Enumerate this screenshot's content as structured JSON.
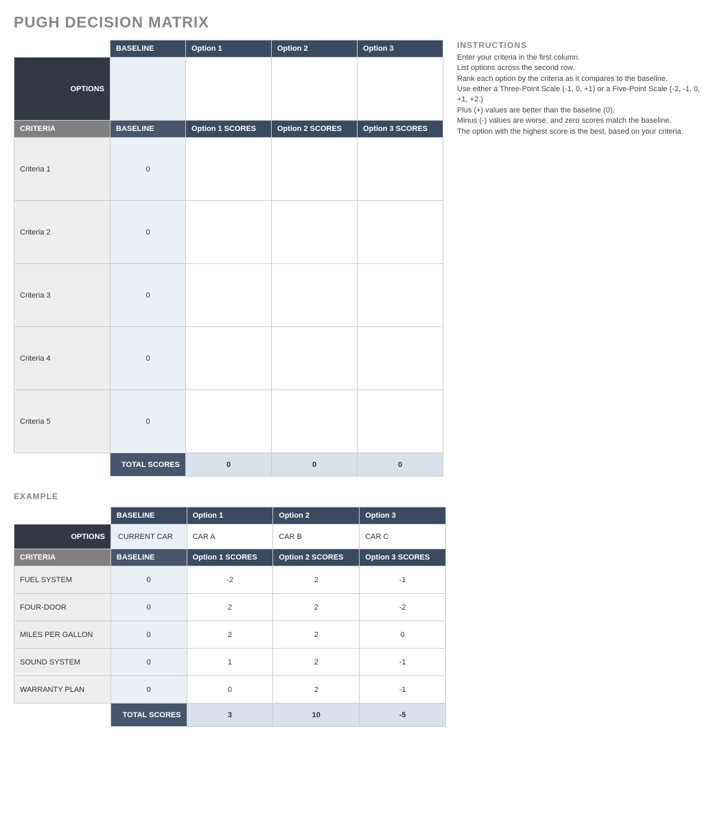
{
  "title": "PUGH DECISION MATRIX",
  "main": {
    "corner_label": "OPTIONS",
    "criteria_header": "CRITERIA",
    "baseline_header": "BASELINE",
    "option_headers": [
      "Option 1",
      "Option 2",
      "Option 3"
    ],
    "score_headers": [
      "BASELINE",
      "Option 1 SCORES",
      "Option 2 SCORES",
      "Option 3 SCORES"
    ],
    "criteria": [
      {
        "label": "Criteria 1",
        "baseline": "0",
        "scores": [
          "",
          "",
          ""
        ]
      },
      {
        "label": "Criteria 2",
        "baseline": "0",
        "scores": [
          "",
          "",
          ""
        ]
      },
      {
        "label": "Criteria 3",
        "baseline": "0",
        "scores": [
          "",
          "",
          ""
        ]
      },
      {
        "label": "Criteria 4",
        "baseline": "0",
        "scores": [
          "",
          "",
          ""
        ]
      },
      {
        "label": "Criteria 5",
        "baseline": "0",
        "scores": [
          "",
          "",
          ""
        ]
      }
    ],
    "total_label": "TOTAL SCORES",
    "totals": [
      "0",
      "0",
      "0"
    ]
  },
  "instructions": {
    "head": "INSTRUCTIONS",
    "lines": [
      "Enter your criteria in the first column.",
      "List options across the second row.",
      "Rank each option by the criteria as it compares to the baseline.",
      "Use either a Three-Point Scale (-1, 0, +1) or a Five-Point Scale (-2, -1, 0, +1, +2.)",
      "Plus (+) values are better than the baseline (0).",
      "Minus (-) values are worse, and zero scores match the baseline.",
      "The option with the highest score is the best, based on your criteria."
    ]
  },
  "example": {
    "title": "EXAMPLE",
    "corner_label": "OPTIONS",
    "criteria_header": "CRITERIA",
    "baseline_header": "BASELINE",
    "option_headers": [
      "Option 1",
      "Option 2",
      "Option 3"
    ],
    "option_values": [
      "CURRENT CAR",
      "CAR A",
      "CAR B",
      "CAR C"
    ],
    "score_headers": [
      "BASELINE",
      "Option 1 SCORES",
      "Option 2 SCORES",
      "Option 3 SCORES"
    ],
    "criteria": [
      {
        "label": "FUEL SYSTEM",
        "baseline": "0",
        "scores": [
          "-2",
          "2",
          "-1"
        ]
      },
      {
        "label": "FOUR-DOOR",
        "baseline": "0",
        "scores": [
          "2",
          "2",
          "-2"
        ]
      },
      {
        "label": "MILES PER GALLON",
        "baseline": "0",
        "scores": [
          "2",
          "2",
          "0"
        ]
      },
      {
        "label": "SOUND SYSTEM",
        "baseline": "0",
        "scores": [
          "1",
          "2",
          "-1"
        ]
      },
      {
        "label": "WARRANTY PLAN",
        "baseline": "0",
        "scores": [
          "0",
          "2",
          "-1"
        ]
      }
    ],
    "total_label": "TOTAL SCORES",
    "totals": [
      "3",
      "10",
      "-5"
    ]
  }
}
